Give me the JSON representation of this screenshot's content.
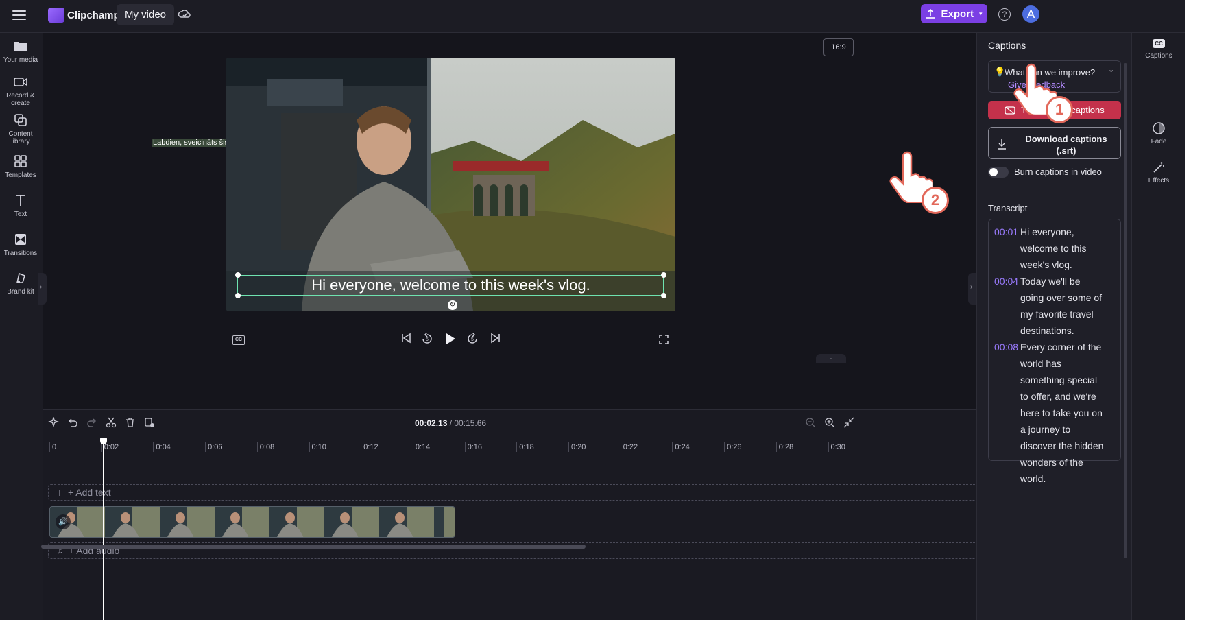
{
  "app": {
    "name": "Clipchamp",
    "project_title": "My video"
  },
  "topbar": {
    "export_label": "Export",
    "help_icon": "question-icon",
    "avatar_initial": "A",
    "colors": {
      "export": "#7b3fe4",
      "avatar": "#4c6de0"
    }
  },
  "sidebar": {
    "items": [
      {
        "label": "Your media",
        "icon": "folder-icon"
      },
      {
        "label": "Record & create",
        "icon": "camera-icon"
      },
      {
        "label": "Content library",
        "icon": "library-icon"
      },
      {
        "label": "Templates",
        "icon": "grid-icon"
      },
      {
        "label": "Text",
        "icon": "text-icon"
      },
      {
        "label": "Transitions",
        "icon": "transitions-icon"
      },
      {
        "label": "Brand kit",
        "icon": "brand-icon"
      }
    ]
  },
  "preview": {
    "aspect_ratio": "16:9",
    "caption_line": "Labdien, sveicināts šis nedēļas žurnālā!",
    "subtitle": "Hi everyone, welcome to this week's vlog."
  },
  "timeline": {
    "current_time": "00:02.13",
    "total_time": "/ 00:15.66",
    "ticks": [
      "0",
      "0:02",
      "0:04",
      "0:06",
      "0:08",
      "0:10",
      "0:12",
      "0:14",
      "0:16",
      "0:18",
      "0:20",
      "0:22",
      "0:24",
      "0:26",
      "0:28",
      "0:30"
    ],
    "add_text": "+ Add text",
    "add_audio": "+ Add audio"
  },
  "captions_panel": {
    "title": "Captions",
    "feedback_question": "What can we improve?",
    "feedback_link": "Give feedback",
    "turn_off_label": "Turn off autocaptions",
    "download_label_line1": "Download captions",
    "download_label_line2": "(.srt)",
    "burn_toggle_label": "Burn captions in video",
    "transcript_title": "Transcript",
    "transcript": [
      {
        "time": "00:01",
        "lines": [
          "Hi everyone,",
          "welcome to this",
          "week's vlog."
        ]
      },
      {
        "time": "00:04",
        "lines": [
          "Today we'll be",
          "going over some of",
          "my favorite travel",
          "destinations."
        ]
      },
      {
        "time": "00:08",
        "lines": [
          "Every corner of the",
          "world has",
          "something special",
          "to offer, and we're",
          "here to take you on",
          "a journey to",
          "discover the hidden",
          "wonders of the",
          "world."
        ]
      }
    ],
    "colors": {
      "turn_off": "#c4314b",
      "timestamp": "#9a7bff"
    }
  },
  "property_rail": {
    "items": [
      {
        "label": "Captions",
        "icon": "cc-icon"
      },
      {
        "label": "Fade",
        "icon": "fade-icon"
      },
      {
        "label": "Effects",
        "icon": "effects-icon"
      }
    ]
  },
  "annotations": {
    "step1": "1",
    "step2": "2"
  }
}
